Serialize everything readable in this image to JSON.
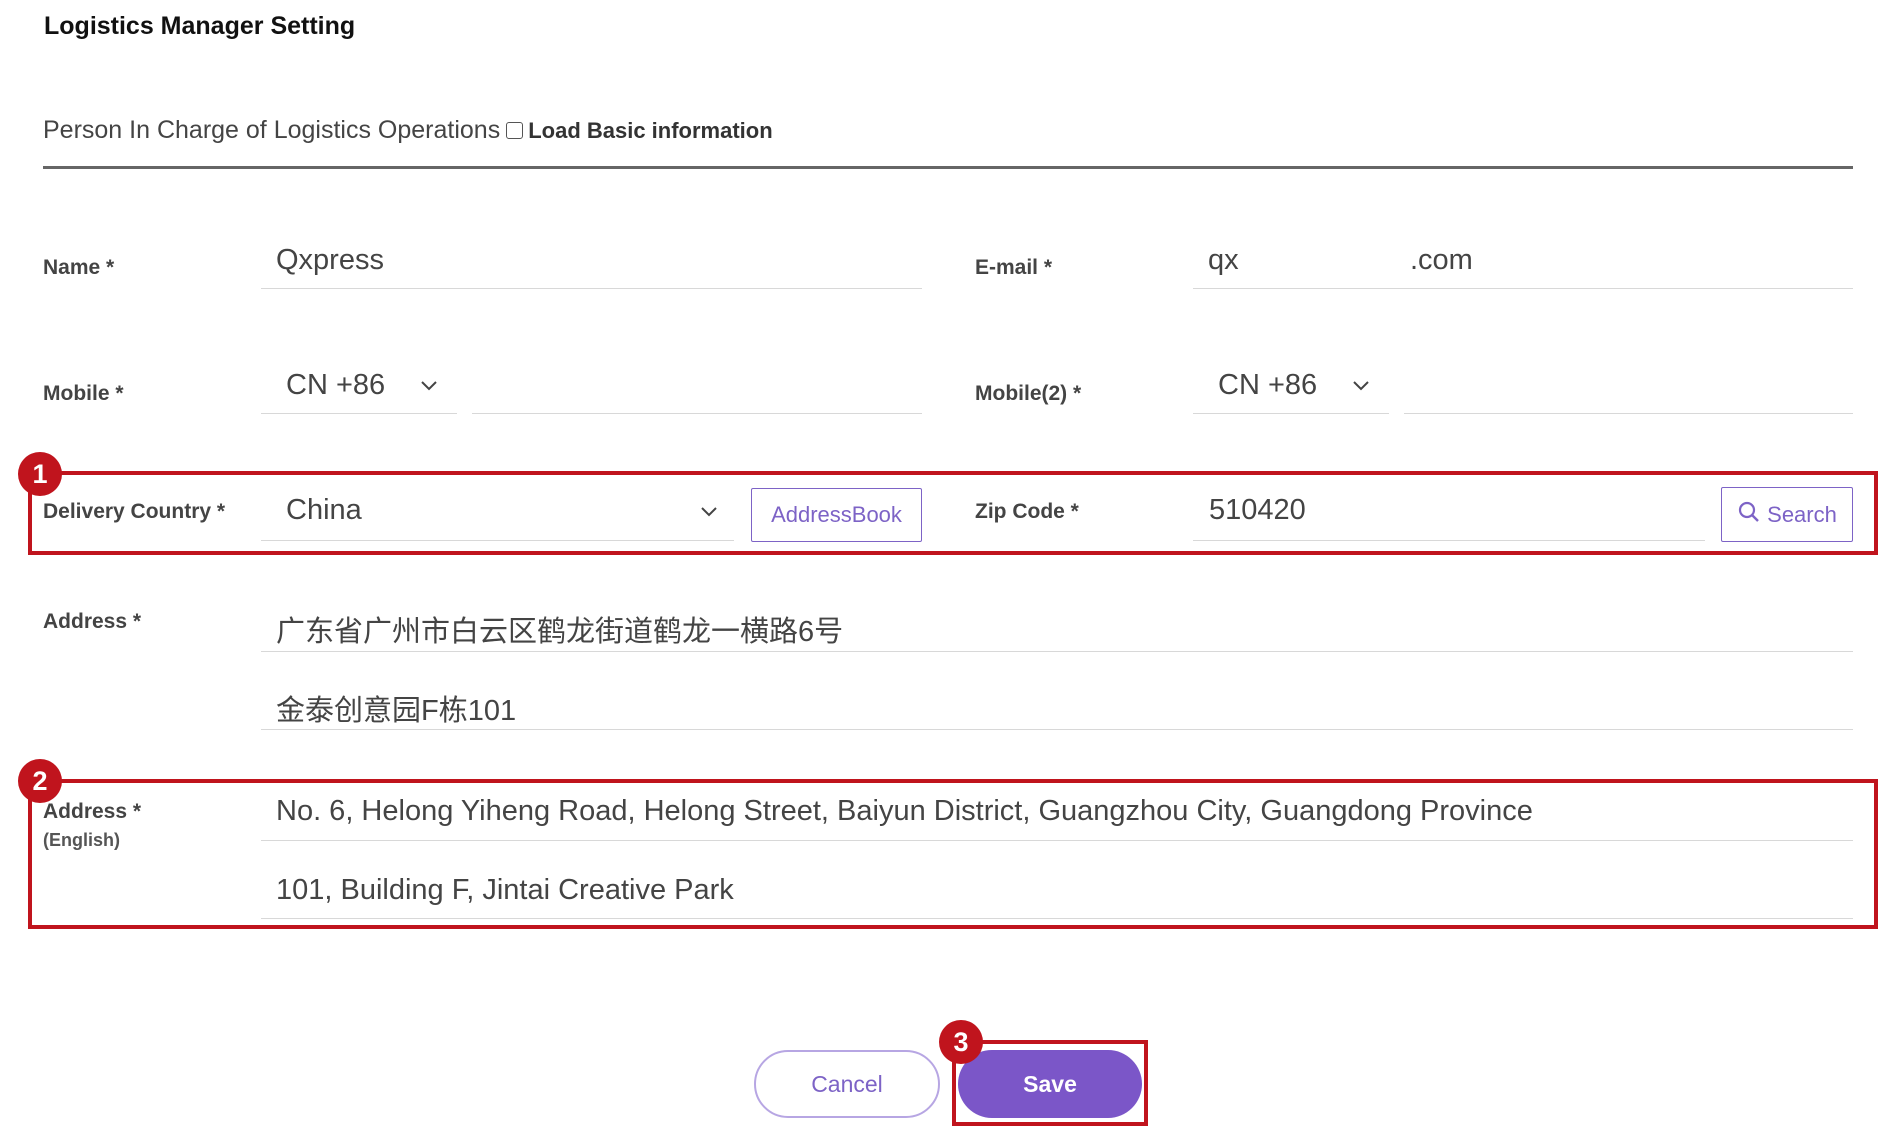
{
  "page": {
    "title": "Logistics Manager Setting"
  },
  "section": {
    "title": "Person In Charge of Logistics Operations",
    "load_basic_label": "Load Basic information",
    "load_basic_checked": false
  },
  "name": {
    "label": "Name *",
    "value": "Qxpress"
  },
  "email": {
    "label": "E-mail *",
    "value_prefix": "qx",
    "value_suffix": ".com"
  },
  "mobile": {
    "label": "Mobile *",
    "country_code": "CN +86",
    "number": ""
  },
  "mobile2": {
    "label": "Mobile(2) *",
    "country_code": "CN +86",
    "number": ""
  },
  "delivery_country": {
    "label": "Delivery Country *",
    "value": "China",
    "addressbook_button": "AddressBook"
  },
  "zip": {
    "label": "Zip Code *",
    "value": "510420",
    "search_button": "Search"
  },
  "address": {
    "label": "Address *",
    "line1": "广东省广州市白云区鹤龙街道鹤龙一横路6号",
    "line2": "金泰创意园F栋101"
  },
  "address_en": {
    "label": "Address *",
    "sublabel": "(English)",
    "line1": "No. 6, Helong Yiheng Road, Helong Street, Baiyun District, Guangzhou City, Guangdong Province",
    "line2": "101, Building F, Jintai Creative Park"
  },
  "actions": {
    "cancel_label": "Cancel",
    "save_label": "Save"
  },
  "annotations": {
    "badge1": "1",
    "badge2": "2",
    "badge3": "3"
  },
  "colors": {
    "accent": "#7b56c8",
    "highlight": "#c0141d"
  },
  "icons": {
    "dropdown": "chevron-down-icon",
    "search": "search-icon"
  }
}
